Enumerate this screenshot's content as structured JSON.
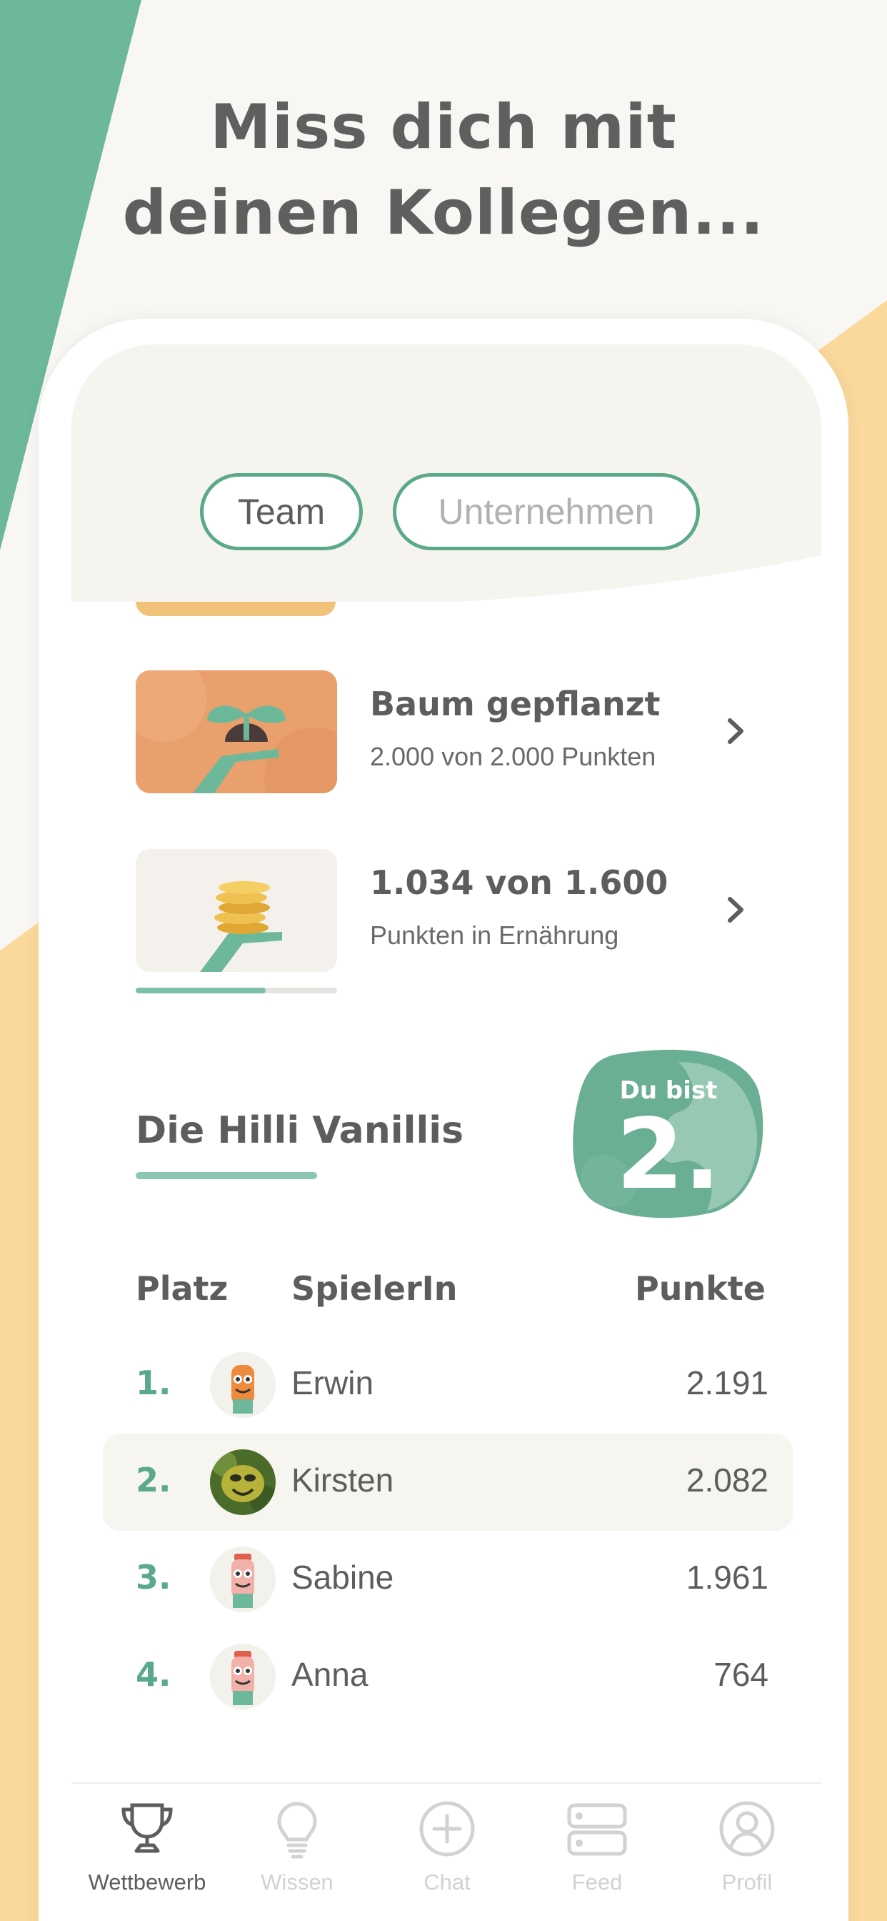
{
  "headline": {
    "line1": "Miss dich mit",
    "line2": "deinen Kollegen..."
  },
  "colors": {
    "accent_green": "#5aa98a",
    "bg_green": "#6db89a",
    "bg_yellow": "#fbd99d",
    "text": "#5d5d5d"
  },
  "segments": [
    {
      "label": "Team",
      "selected": true
    },
    {
      "label": "Unternehmen",
      "selected": false
    }
  ],
  "achievements": [
    {
      "title": "Baum gepflanzt",
      "subtitle": "2.000 von 2.000 Punkten",
      "thumb_icon": "sprout-in-hand-icon"
    },
    {
      "title": "1.034 von 1.600",
      "subtitle": "Punkten in Ernährung",
      "thumb_icon": "coins-in-hand-icon",
      "progress": 0.646
    }
  ],
  "team": {
    "name": "Die Hilli Vanillis",
    "rank_label": "Du bist",
    "rank_value": "2."
  },
  "leaderboard": {
    "headers": {
      "rank": "Platz",
      "player": "SpielerIn",
      "points": "Punkte"
    },
    "rows": [
      {
        "rank": "1.",
        "name": "Erwin",
        "points": "2.191",
        "highlight": false
      },
      {
        "rank": "2.",
        "name": "Kirsten",
        "points": "2.082",
        "highlight": true
      },
      {
        "rank": "3.",
        "name": "Sabine",
        "points": "1.961",
        "highlight": false
      },
      {
        "rank": "4.",
        "name": "Anna",
        "points": "764",
        "highlight": false
      }
    ]
  },
  "tabbar": [
    {
      "label": "Wettbewerb",
      "icon": "trophy-icon",
      "active": true
    },
    {
      "label": "Wissen",
      "icon": "lightbulb-icon",
      "active": false
    },
    {
      "label": "Chat",
      "icon": "plus-circle-icon",
      "active": false
    },
    {
      "label": "Feed",
      "icon": "feed-icon",
      "active": false
    },
    {
      "label": "Profil",
      "icon": "profile-icon",
      "active": false
    }
  ]
}
